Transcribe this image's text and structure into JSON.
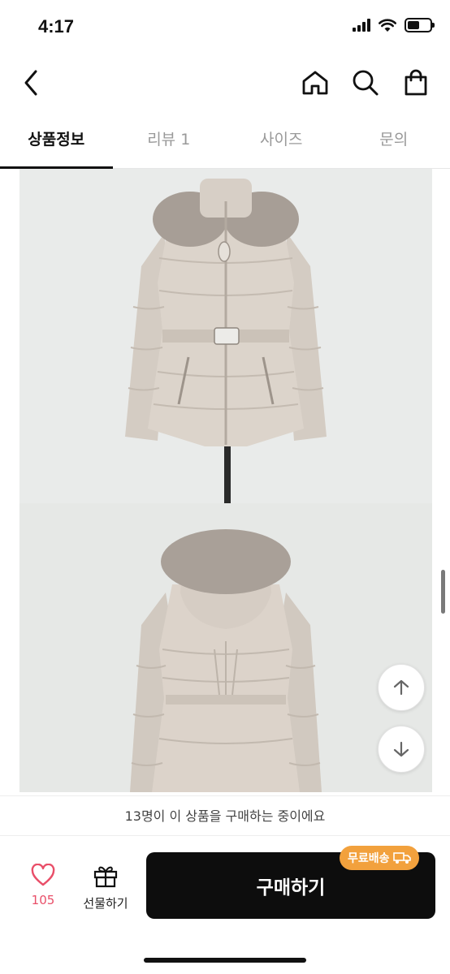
{
  "status": {
    "time": "4:17"
  },
  "tabs": [
    {
      "label": "상품정보",
      "active": true
    },
    {
      "label": "리뷰 1",
      "active": false
    },
    {
      "label": "사이즈",
      "active": false
    },
    {
      "label": "문의",
      "active": false
    }
  ],
  "icons": {
    "back": "chevron-left-icon",
    "home": "home-icon",
    "search": "search-icon",
    "bag": "shopping-bag-icon",
    "heart": "heart-icon",
    "gift": "gift-icon",
    "scroll_up": "arrow-up-icon",
    "scroll_down": "arrow-down-icon",
    "truck": "truck-icon"
  },
  "banner": {
    "text": "13명이 이 상품을 구매하는 중이에요"
  },
  "bottom": {
    "like_count": "105",
    "gift_label": "선물하기",
    "buy_label": "구매하기",
    "free_shipping": "무료배송"
  },
  "colors": {
    "accent_like": "#e94f69",
    "free_shipping_bg": "#f2a13d",
    "buy_button_bg": "#0d0d0d"
  }
}
